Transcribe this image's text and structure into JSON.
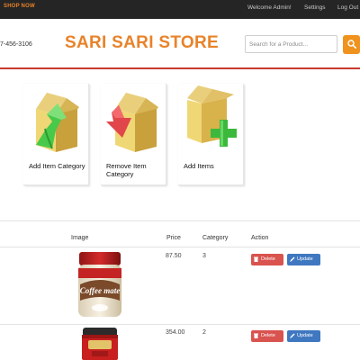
{
  "topbar": {
    "brand": "SHOP NOW",
    "welcome": "Welcome Admin!",
    "settings": "Settings",
    "logout": "Log Out"
  },
  "header": {
    "phone": "7-456-3106",
    "store_name": "SARI SARI STORE",
    "search_placeholder": "Search for a Product..."
  },
  "tiles": [
    {
      "label": "Add Item Category",
      "icon": "box-up-arrow-icon"
    },
    {
      "label": "Remove Item Category",
      "icon": "box-down-arrow-icon"
    },
    {
      "label": "Add Items",
      "icon": "box-plus-icon"
    }
  ],
  "table": {
    "headers": {
      "image": "Image",
      "price": "Price",
      "category": "Category",
      "action": "Action"
    },
    "rows": [
      {
        "product": "Coffee mate",
        "price": "87.50",
        "category": "3",
        "delete": "Delete",
        "update": "Update"
      },
      {
        "product": "",
        "price": "354.00",
        "category": "2",
        "delete": "Delete",
        "update": "Update"
      }
    ]
  },
  "colors": {
    "accent": "#e8832a",
    "topbar": "#252525",
    "rule": "#c9392f",
    "delete": "#d9534f",
    "update": "#3f78c0"
  }
}
